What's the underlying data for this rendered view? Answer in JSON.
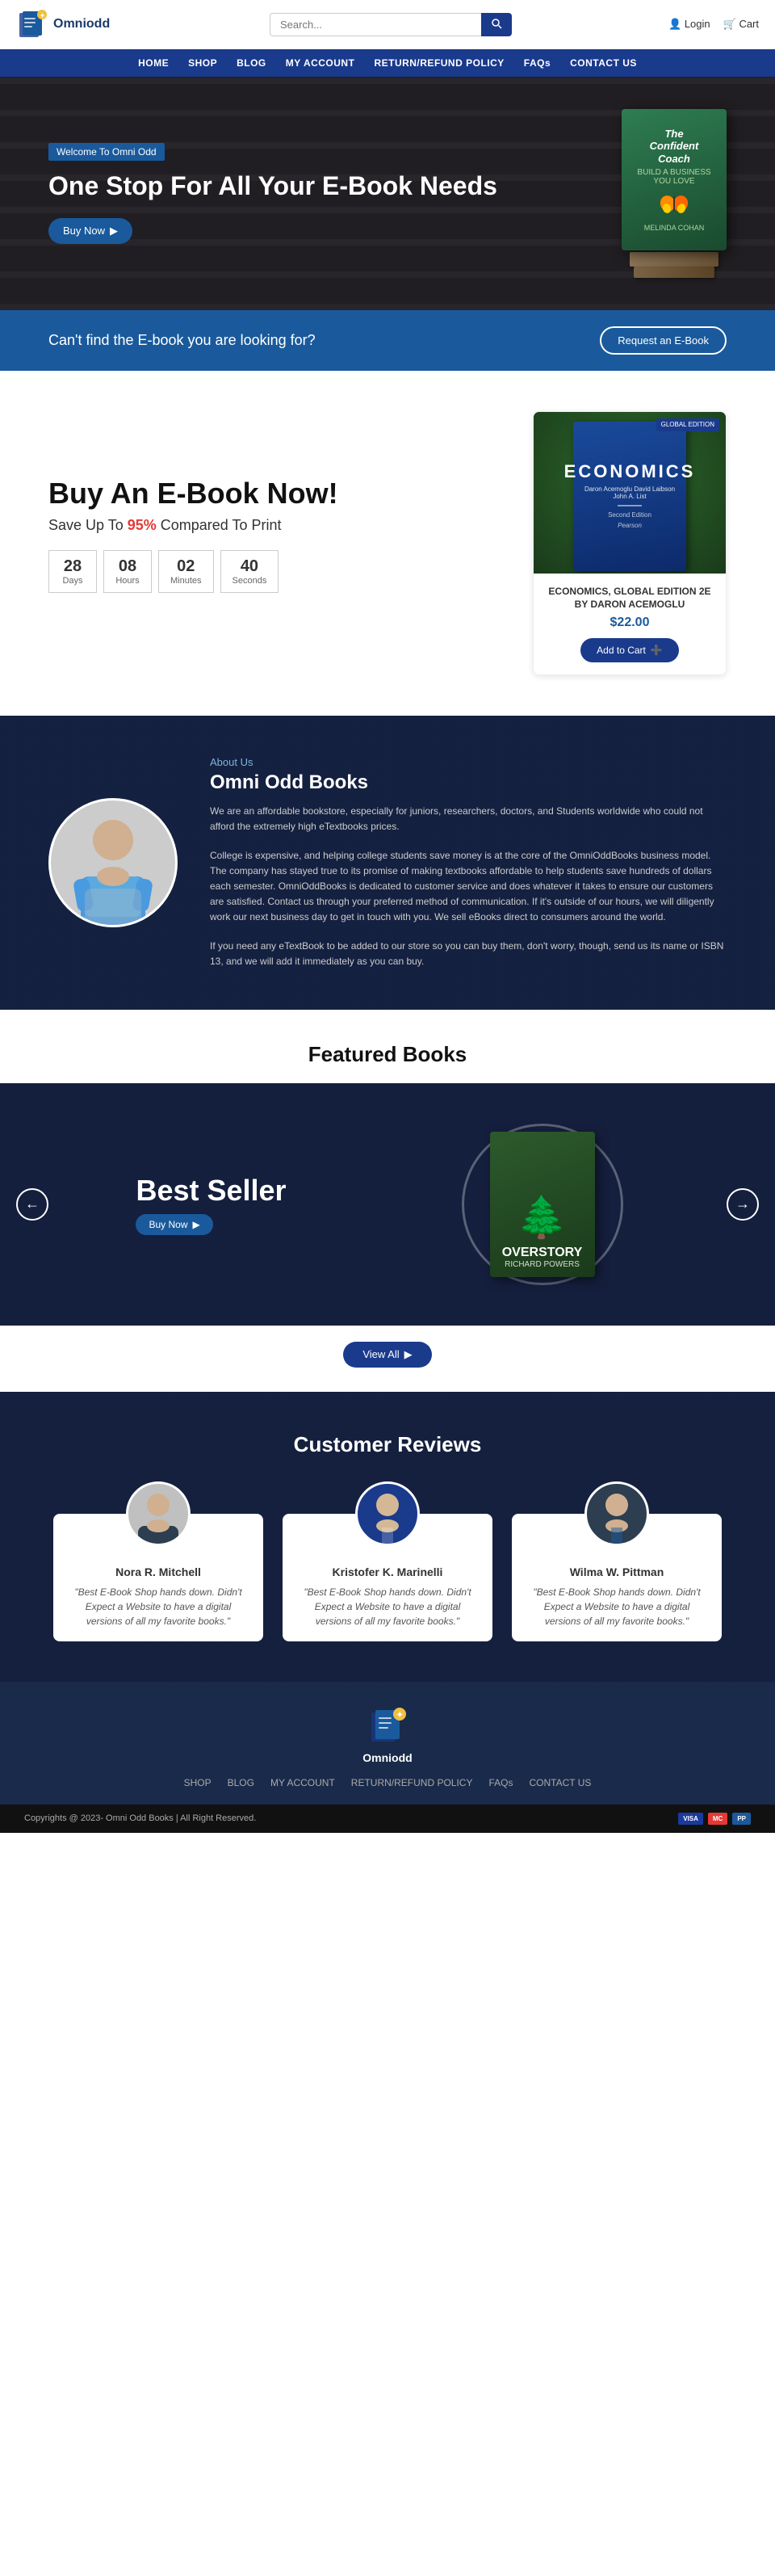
{
  "header": {
    "logo_text": "Omniodd",
    "search_placeholder": "Search...",
    "login_label": "Login",
    "cart_label": "Cart"
  },
  "nav": {
    "items": [
      {
        "label": "HOME",
        "href": "#"
      },
      {
        "label": "SHOP",
        "href": "#"
      },
      {
        "label": "BLOG",
        "href": "#"
      },
      {
        "label": "MY ACCOUNT",
        "href": "#"
      },
      {
        "label": "RETURN/REFUND POLICY",
        "href": "#"
      },
      {
        "label": "FAQs",
        "href": "#"
      },
      {
        "label": "CONTACT US",
        "href": "#"
      }
    ]
  },
  "hero": {
    "badge": "Welcome To Omni Odd",
    "title": "One Stop For All Your E-Book Needs",
    "btn_label": "Buy Now",
    "book_title": "The Confident Coach",
    "book_author": "MELINDA COHAN"
  },
  "info_banner": {
    "text": "Can't find the E-book you are looking for?",
    "btn_label": "Request an E-Book"
  },
  "offer": {
    "title": "Buy An E-Book Now!",
    "subtitle_pre": "Save Up To ",
    "subtitle_highlight": "95%",
    "subtitle_post": " Compared To Print",
    "countdown": [
      {
        "num": "28",
        "label": "Days"
      },
      {
        "num": "08",
        "label": "Hours"
      },
      {
        "num": "02",
        "label": "Minutes"
      },
      {
        "num": "40",
        "label": "Seconds"
      }
    ],
    "book_card": {
      "badge": "GLOBAL EDITION",
      "title": "ECONOMICS",
      "authors": "Daron Acemoglu David Laibson John A. List",
      "edition": "Second Edition",
      "publisher": "Pearson",
      "name": "ECONOMICS, GLOBAL EDITION 2E BY DARON ACEMOGLU",
      "price": "$22.00",
      "add_to_cart": "Add to Cart"
    }
  },
  "about": {
    "label": "About Us",
    "company": "Omni Odd Books",
    "desc1": "We are an affordable bookstore, especially for juniors, researchers, doctors, and Students worldwide who could not afford the extremely high eTextbooks prices.",
    "desc2": "College is expensive, and helping college students save money is at the core of the OmniOddBooks business model. The company has stayed true to its promise of making textbooks affordable to help students save hundreds of dollars each semester. OmniOddBooks is dedicated to customer service and does whatever it takes to ensure our customers are satisfied. Contact us through your preferred method of communication. If it's outside of our hours, we will diligently work our next business day to get in touch with you. We sell eBooks direct to consumers around the world.",
    "desc3": "If you need any eTextBook to be added to our store so you can buy them, don't worry, though, send us its name or ISBN 13, and we will add it immediately as you can buy."
  },
  "featured": {
    "title": "Featured Books",
    "best_seller": "Best Seller",
    "buy_now": "Buy Now",
    "book_title": "OVERSTORY",
    "book_author": "RICHARD POWERS",
    "view_all": "View All"
  },
  "reviews": {
    "title": "Customer Reviews",
    "items": [
      {
        "name": "Nora R. Mitchell",
        "text": "\"Best E-Book Shop hands down. Didn't Expect a Website to have a digital versions of all my favorite books.\""
      },
      {
        "name": "Kristofer K. Marinelli",
        "text": "\"Best E-Book Shop hands down. Didn't Expect a Website to have a digital versions of all my favorite books.\""
      },
      {
        "name": "Wilma W. Pittman",
        "text": "\"Best E-Book Shop hands down. Didn't Expect a Website to have a digital versions of all my favorite books.\""
      }
    ]
  },
  "footer": {
    "logo_text": "Omniodd",
    "links": [
      {
        "label": "SHOP",
        "href": "#"
      },
      {
        "label": "BLOG",
        "href": "#"
      },
      {
        "label": "MY ACCOUNT",
        "href": "#"
      },
      {
        "label": "RETURN/REFUND POLICY",
        "href": "#"
      },
      {
        "label": "FAQs",
        "href": "#"
      },
      {
        "label": "CONTACT US",
        "href": "#"
      }
    ],
    "copyright": "Copyrights @ 2023- Omni Odd Books | All Right Reserved.",
    "payment_icons": [
      "VISA",
      "MC",
      "PP"
    ]
  }
}
